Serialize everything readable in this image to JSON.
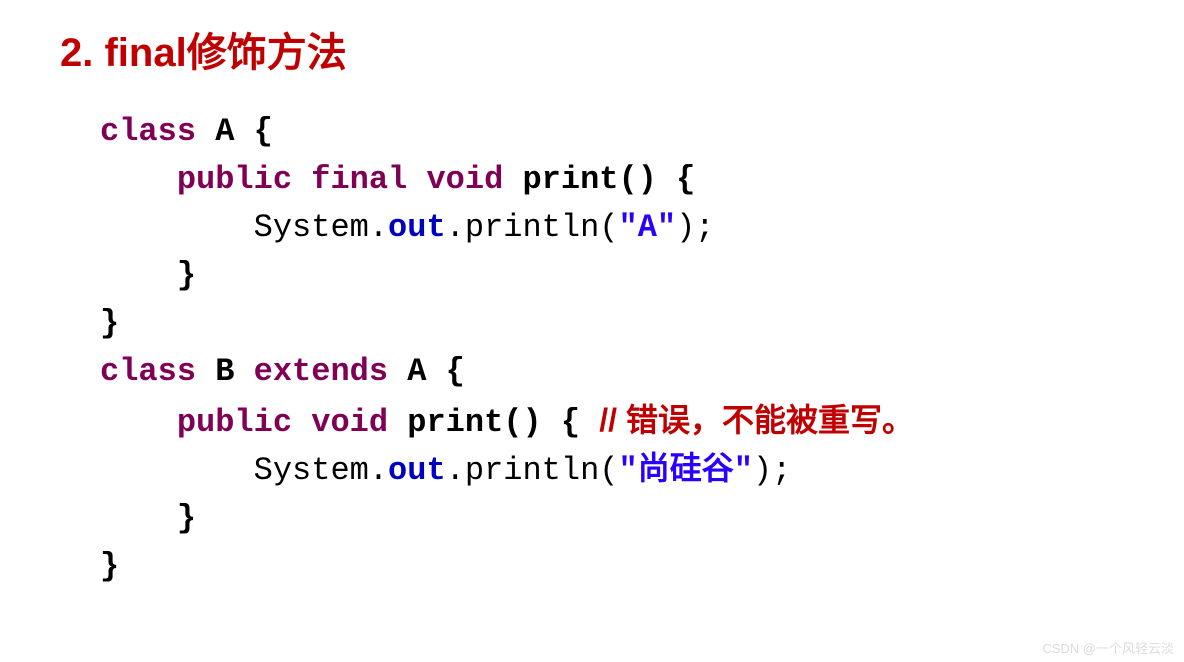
{
  "heading": "2. final修饰方法",
  "code": {
    "l1_kw1": "class",
    "l1_id": " A {",
    "l2_indent": "    ",
    "l2_kw1": "public",
    "l2_sp1": " ",
    "l2_kw2": "final",
    "l2_sp2": " ",
    "l2_kw3": "void",
    "l2_sp3": " ",
    "l2_id": "print() {",
    "l3_indent": "        ",
    "l3_t1": "System.",
    "l3_field": "out",
    "l3_t2": ".println(",
    "l3_str": "\"A\"",
    "l3_t3": ");",
    "l4": "    }",
    "l5": "}",
    "l6": "",
    "l7_kw1": "class",
    "l7_id1": " B ",
    "l7_kw2": "extends",
    "l7_id2": " A {",
    "l8_indent": "    ",
    "l8_kw1": "public",
    "l8_sp1": " ",
    "l8_kw2": "void",
    "l8_sp2": " ",
    "l8_id": "print() { ",
    "l8_comment": "// 错误，不能被重写。",
    "l9_indent": "        ",
    "l9_t1": "System.",
    "l9_field": "out",
    "l9_t2": ".println(",
    "l9_str": "\"尚硅谷\"",
    "l9_t3": ");",
    "l10": "    }",
    "l11": "}"
  },
  "watermark": "CSDN @一个风轻云淡"
}
